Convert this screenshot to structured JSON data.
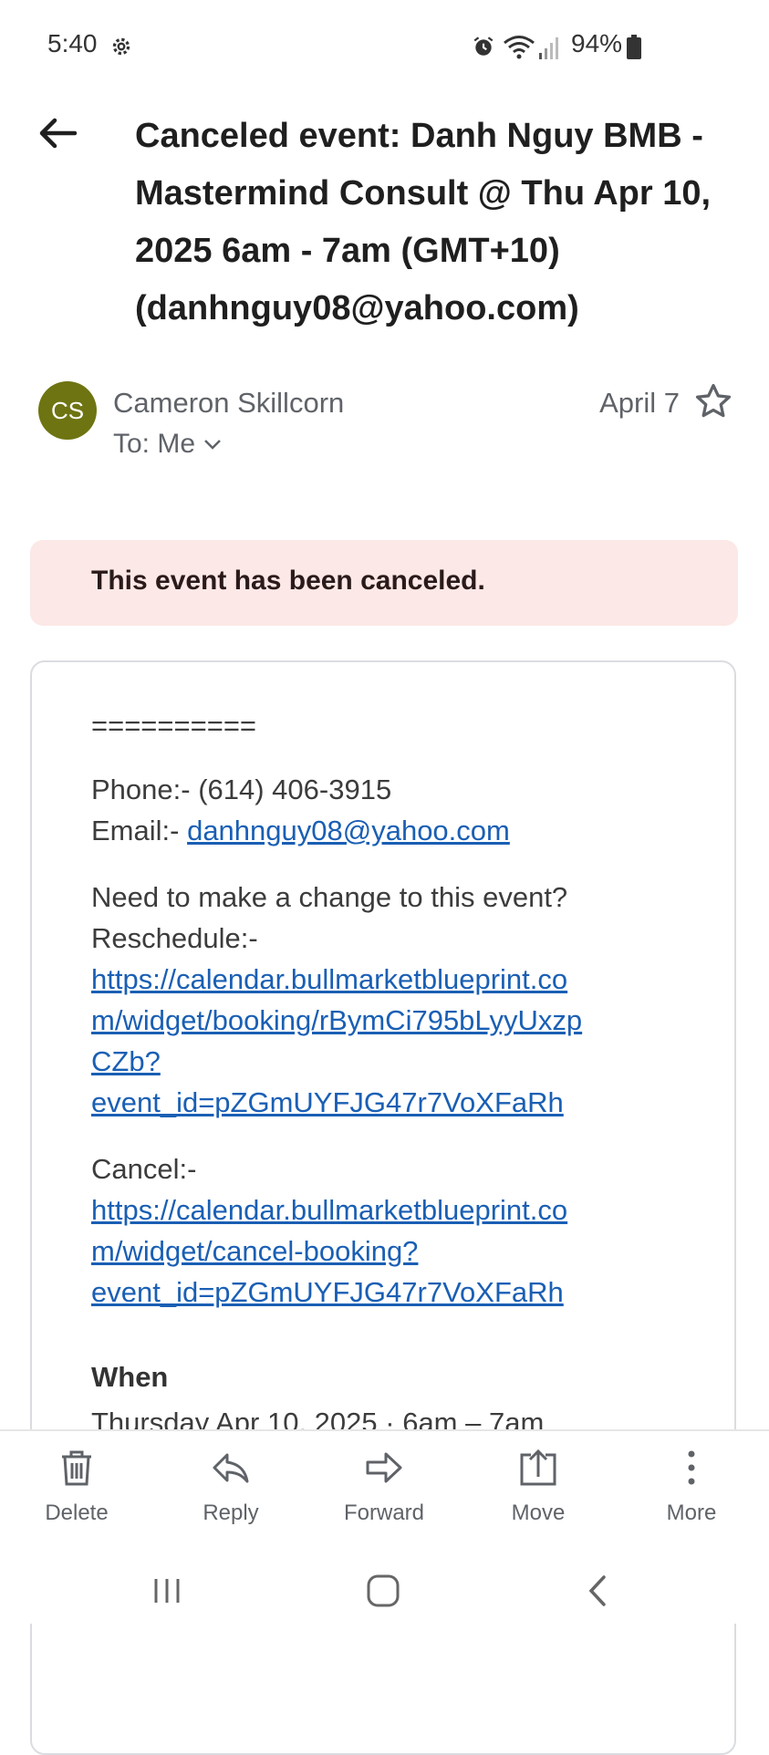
{
  "status_bar": {
    "time": "5:40",
    "battery": "94%",
    "icons": [
      "settings-icon",
      "alarm-icon",
      "wifi-icon",
      "signal-icon",
      "battery-icon"
    ]
  },
  "email": {
    "subject": "Canceled event: Danh Nguy BMB - Mastermind Consult @ Thu Apr 10, 2025 6am - 7am (GMT+10) (danhnguy08@yahoo.com)",
    "sender_initials": "CS",
    "sender_name": "Cameron Skillcorn",
    "to": "To: Me",
    "date": "April 7",
    "avatar_color": "#6e7411",
    "banner_text": "This event has been canceled.",
    "body": {
      "separator": "==========",
      "phone": "Phone:- (614) 406-3915",
      "email_label": "Email:-",
      "email_link": "danhnguy08@yahoo.com",
      "change_prompt": "Need to make a change to this event?",
      "reschedule_label": "Reschedule:-",
      "reschedule_link_lines": [
        "https://calendar.bullmarketblueprint.co",
        "m/widget/booking/rBymCi795bLyyUxzp",
        "CZb?",
        "event_id=pZGmUYFJG47r7VoXFaRh"
      ],
      "cancel_label": "Cancel:-",
      "cancel_link_lines": [
        "https://calendar.bullmarketblueprint.co",
        "m/widget/cancel-booking?",
        "event_id=pZGmUYFJG47r7VoXFaRh"
      ],
      "when_label": "When",
      "when_value": "Thursday Apr 10, 2025 · 6am – 7am"
    }
  },
  "toolbar": {
    "delete": "Delete",
    "reply": "Reply",
    "forward": "Forward",
    "move": "Move",
    "more": "More"
  },
  "colors": {
    "link": "#1a5fb4",
    "banner_bg": "#fce8e6",
    "secondary_text": "#5f6368"
  }
}
